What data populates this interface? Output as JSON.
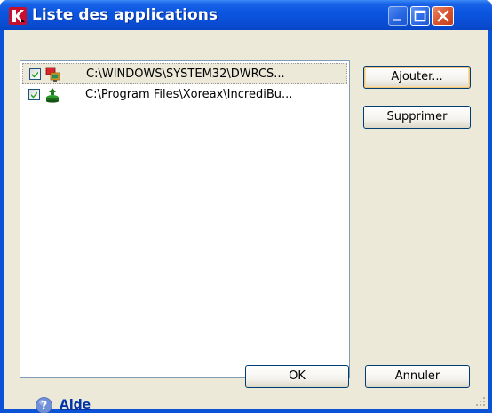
{
  "window": {
    "title": "Liste des applications"
  },
  "apps": [
    {
      "checked": true,
      "path": "C:\\WINDOWS\\SYSTEM32\\DWRCS...",
      "icon": "remote-control-icon"
    },
    {
      "checked": true,
      "path": "C:\\Program Files\\Xoreax\\IncrediBu...",
      "icon": "incredibuild-icon"
    }
  ],
  "buttons": {
    "add": "Ajouter...",
    "remove": "Supprimer",
    "ok": "OK",
    "cancel": "Annuler"
  },
  "help": {
    "label": "Aide"
  },
  "colors": {
    "titlebar": "#0A53D6",
    "client": "#ECE9D8",
    "link": "#0034A8",
    "close": "#D9542F"
  }
}
